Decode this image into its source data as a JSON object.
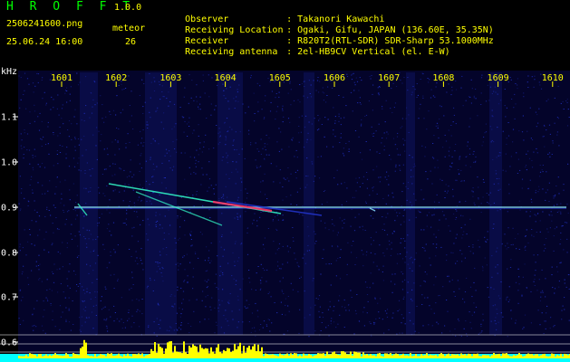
{
  "app": {
    "brand": "H R O F F T",
    "version": "1.0.0",
    "filename": "2506241600.png",
    "datetime": "25.06.24 16:00",
    "meteor_label": "meteor",
    "meteor_count": "26"
  },
  "info": [
    {
      "label": "Observer",
      "sep": ":",
      "value": "Takanori Kawachi"
    },
    {
      "label": "Receiving Location",
      "sep": ":",
      "value": "Ogaki, Gifu, JAPAN (136.60E, 35.35N)"
    },
    {
      "label": "Receiver",
      "sep": ":",
      "value": "R820T2(RTL-SDR) SDR-Sharp 53.1000MHz"
    },
    {
      "label": "Receiving antenna",
      "sep": ":",
      "value": "2el-HB9CV Vertical (el. E-W)"
    }
  ],
  "spectrogram": {
    "unit_label": "kHz",
    "x_ticks": [
      "1601",
      "1602",
      "1603",
      "1604",
      "1605",
      "1606",
      "1607",
      "1608",
      "1609",
      "1610"
    ],
    "y_ticks": [
      "1.1",
      "1.0",
      "0.9",
      "0.8",
      "0.7",
      "0.6"
    ],
    "colors": {
      "background": "#04042a",
      "noise": "#2233c8",
      "carrier": "#8fe8ff",
      "echo_hot": "#ff3366",
      "echo": "#33ffcc",
      "level_bar": "#ffff00",
      "baseline": "#00ffff",
      "tick": "#ffff00",
      "grid": "#ffffff"
    }
  }
}
